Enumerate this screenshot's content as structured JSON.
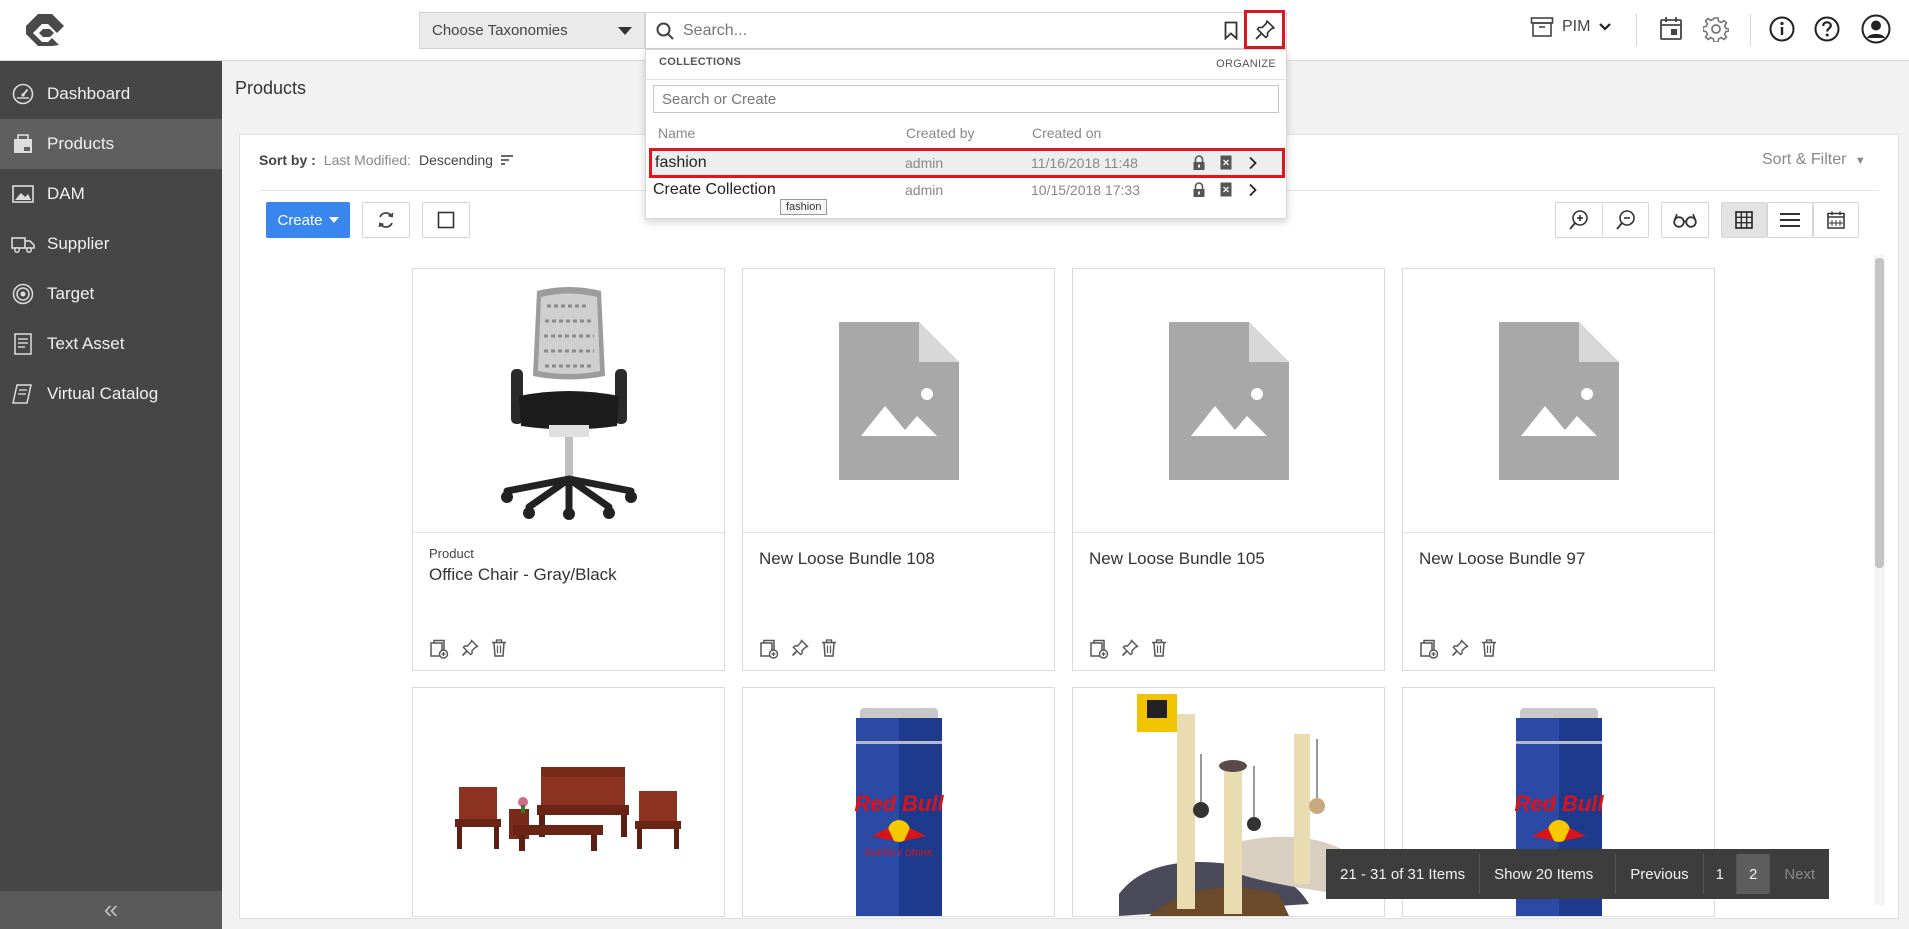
{
  "header": {
    "taxonomy_select": "Choose Taxonomies",
    "search_placeholder": "Search...",
    "module_switch": "PIM"
  },
  "sidebar": {
    "items": [
      {
        "label": "Dashboard",
        "icon": "dashboard-icon"
      },
      {
        "label": "Products",
        "icon": "products-icon",
        "active": true
      },
      {
        "label": "DAM",
        "icon": "image-icon"
      },
      {
        "label": "Supplier",
        "icon": "truck-icon"
      },
      {
        "label": "Target",
        "icon": "target-icon"
      },
      {
        "label": "Text Asset",
        "icon": "text-document-icon"
      },
      {
        "label": "Virtual Catalog",
        "icon": "catalog-icon"
      }
    ],
    "collapse_label": "«"
  },
  "page": {
    "title": "Products",
    "sort_by_label": "Sort by :",
    "sort_key": "Last Modified:",
    "sort_dir": "Descending",
    "sort_filter_label": "Sort & Filter",
    "create_label": "Create"
  },
  "collections": {
    "header": "COLLECTIONS",
    "organize": "ORGANIZE",
    "search_placeholder": "Search or Create",
    "columns": [
      "Name",
      "Created by",
      "Created on"
    ],
    "rows": [
      {
        "name": "fashion",
        "created_by": "admin",
        "created_on": "11/16/2018 11:48",
        "highlighted": true
      },
      {
        "name": "Create Collection",
        "created_by": "admin",
        "created_on": "10/15/2018 17:33",
        "highlighted": false
      }
    ],
    "tooltip": "fashion"
  },
  "products": [
    {
      "type": "Product",
      "name": "Office Chair - Gray/Black",
      "image": "chair"
    },
    {
      "type": "",
      "name": "New Loose Bundle 108",
      "image": "placeholder"
    },
    {
      "type": "",
      "name": "New Loose Bundle 105",
      "image": "placeholder"
    },
    {
      "type": "",
      "name": "New Loose Bundle 97",
      "image": "placeholder"
    },
    {
      "type": "",
      "name": "",
      "image": "furniture-set"
    },
    {
      "type": "",
      "name": "",
      "image": "energy-drink-can"
    },
    {
      "type": "",
      "name": "",
      "image": "cat-scratcher"
    },
    {
      "type": "",
      "name": "",
      "image": "energy-drink-can"
    }
  ],
  "can_brand": {
    "word": "Red Bull",
    "sub": "ENERGY DRINK"
  },
  "pagination": {
    "range": "21 - 31 of 31 Items",
    "show": "Show 20 Items",
    "previous": "Previous",
    "pages": [
      "1",
      "2"
    ],
    "current_page": "2",
    "next": "Next"
  },
  "colors": {
    "highlight_red": "#e0161f",
    "primary_blue": "#3a86ef",
    "sidebar_bg": "#464646"
  }
}
